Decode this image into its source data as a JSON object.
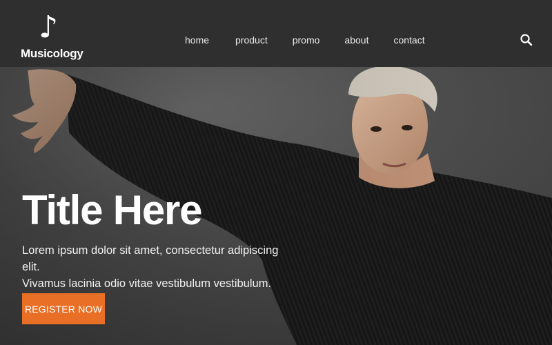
{
  "brand": {
    "name": "Musicology",
    "logo_icon": "music-note-icon"
  },
  "nav": {
    "items": [
      {
        "label": "home"
      },
      {
        "label": "product"
      },
      {
        "label": "promo"
      },
      {
        "label": "about"
      },
      {
        "label": "contact"
      }
    ],
    "search_icon": "search-icon"
  },
  "hero": {
    "title": "Title Here",
    "subtitle_line1": "Lorem ipsum dolor sit amet, consectetur adipiscing elit.",
    "subtitle_line2": "Vivamus lacinia odio vitae vestibulum vestibulum.",
    "cta_label": "REGISTER NOW"
  },
  "colors": {
    "header_bg": "#2f2f2f",
    "accent": "#e86f25",
    "text": "#ffffff"
  }
}
